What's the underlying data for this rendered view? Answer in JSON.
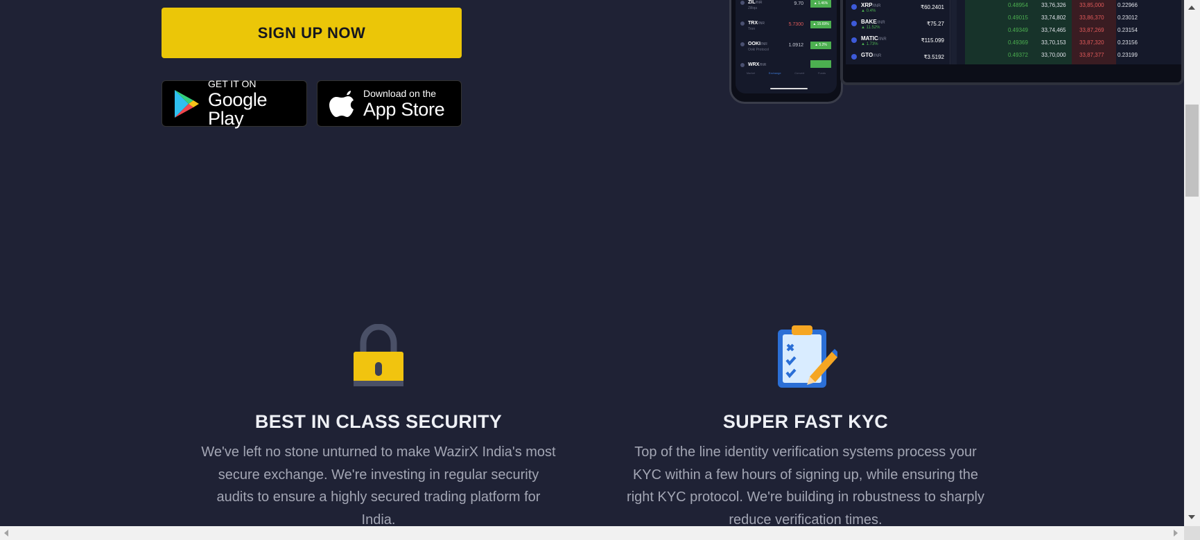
{
  "hero": {
    "signup_label": "SIGN UP NOW",
    "google_play": {
      "small": "GET IT ON",
      "big": "Google Play"
    },
    "app_store": {
      "small": "Download on the",
      "big": "App Store"
    }
  },
  "phone": {
    "rows": [
      {
        "name": "ZIL",
        "quote": "/INR",
        "sub": "Zilliqa",
        "price": "9.70",
        "change": "▲ 1.46%"
      },
      {
        "name": "TRX",
        "quote": "/INR",
        "sub": "Tron",
        "price": "5.7300",
        "change": "▲ 15.69%"
      },
      {
        "name": "OOKI",
        "quote": "/INR",
        "sub": "Ooki Protocol",
        "price": "1.0912",
        "change": "▲ 5.2%"
      },
      {
        "name": "WRX",
        "quote": "/INR",
        "sub": "",
        "price": "",
        "change": ""
      }
    ],
    "nav": [
      "Market",
      "Exchange",
      "Convert",
      "Funds"
    ]
  },
  "tablet": {
    "markets": [
      {
        "name": "XRP",
        "quote": "/INR",
        "change": "▲ 0.4%",
        "price": "₹60.2401"
      },
      {
        "name": "BAKE",
        "quote": "/INR",
        "change": "▲ 11.52%",
        "price": "₹75.27"
      },
      {
        "name": "MATIC",
        "quote": "/INR",
        "change": "▲ 1.73%",
        "price": "₹115.099"
      },
      {
        "name": "GTO",
        "quote": "/INR",
        "change": "",
        "price": "₹3.5192"
      }
    ],
    "book": [
      [
        "0.48954",
        "33,76,326",
        "33,85,000",
        "0.22966"
      ],
      [
        "0.49015",
        "33,74,802",
        "33,86,370",
        "0.23012"
      ],
      [
        "0.49349",
        "33,74,465",
        "33,87,269",
        "0.23154"
      ],
      [
        "0.49369",
        "33,70,153",
        "33,87,320",
        "0.23156"
      ],
      [
        "0.49372",
        "33,70,000",
        "33,87,377",
        "0.23199"
      ]
    ]
  },
  "features": [
    {
      "title": "BEST IN CLASS SECURITY",
      "description": "We've left no stone unturned to make WazirX India's most secure exchange. We're investing in regular security audits to ensure a highly secured trading platform for India.",
      "icon": "padlock-icon"
    },
    {
      "title": "SUPER FAST KYC",
      "description": "Top of the line identity verification systems process your KYC within a few hours of signing up, while ensuring the right KYC protocol. We're building in robustness to sharply reduce verification times.",
      "icon": "clipboard-checklist-icon"
    }
  ],
  "colors": {
    "background": "#1f2235",
    "accent": "#ebc608",
    "positive": "#4caf50",
    "negative": "#e05a5a"
  }
}
